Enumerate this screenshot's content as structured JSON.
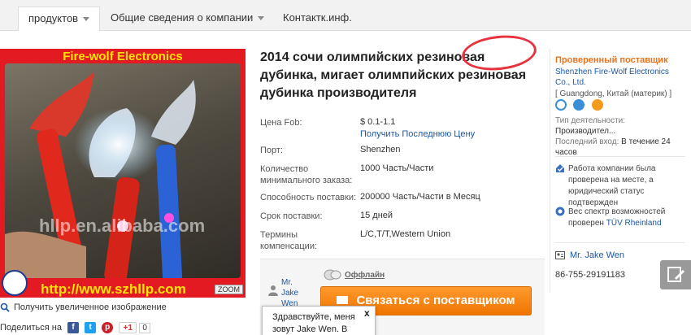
{
  "nav": {
    "tabs": [
      {
        "label": "продуктов",
        "has_dropdown": true,
        "active": true
      },
      {
        "label": "Общие сведения о компании",
        "has_dropdown": true,
        "active": false
      },
      {
        "label": "Контактк.инф.",
        "has_dropdown": false,
        "active": false
      }
    ]
  },
  "image": {
    "brand_text": "Fire-wolf Electronics",
    "watermark": "hllp.en.alibaba.com",
    "url_text": "http://www.szhllp.com",
    "zoom_label": "ZOOM"
  },
  "image_actions": {
    "enlarge_label": "Получить увеличенное изображение",
    "share_label": "Поделиться на",
    "gplus_label": "+1",
    "gplus_count": "0"
  },
  "title": "2014 сочи олимпийских резиновая дубинка, мигает олимпийских резиновая дубинка производителя",
  "specs": {
    "fob_label": "Цена Fob:",
    "fob_value": "$ 0.1-1.1",
    "fob_link": "Получить Последнюю Цену",
    "port_label": "Порт:",
    "port_value": "Shenzhen",
    "moq_label": "Количество минимального заказа:",
    "moq_value": "1000 Часть/Части",
    "supply_label": "Способность поставки:",
    "supply_value": "200000 Часть/Части в Месяц",
    "lead_label": "Срок поставки:",
    "lead_value": "15 дней",
    "payment_label": "Термины компенсации:",
    "payment_value": "L/C,T/T,Western Union"
  },
  "contact": {
    "person_name": "Mr. Jake Wen",
    "status": "Оффлайн",
    "button_label": "Связаться с поставщиком",
    "chat_text": "Здравствуйте, меня зовут Jake Wen. В",
    "chat_close": "x"
  },
  "supplier": {
    "title": "Проверенный поставщик",
    "name": "Shenzhen Fire-Wolf Electronics Co., Ltd.",
    "location": "[ Guangdong, Китай (материк) ]",
    "business_type_label": "Тип деятельности:",
    "business_type_value": "Производител...",
    "last_login_label": "Последний вход:",
    "last_login_value": "В течение 24 часов",
    "verified_onsite": "Работа компании была проверена на месте, а юридический статус подтвержден",
    "scope_text": "Вес спектр возможностей проверен",
    "scope_link": "TÜV Rheinland",
    "contact_person": "Mr. Jake Wen",
    "phone": "86-755-29191183"
  },
  "colors": {
    "accent_orange": "#f07400",
    "link_blue": "#1a57a8",
    "supplier_orange": "#e7731e",
    "image_red": "#e41a23",
    "circle_red": "#e8323e"
  }
}
